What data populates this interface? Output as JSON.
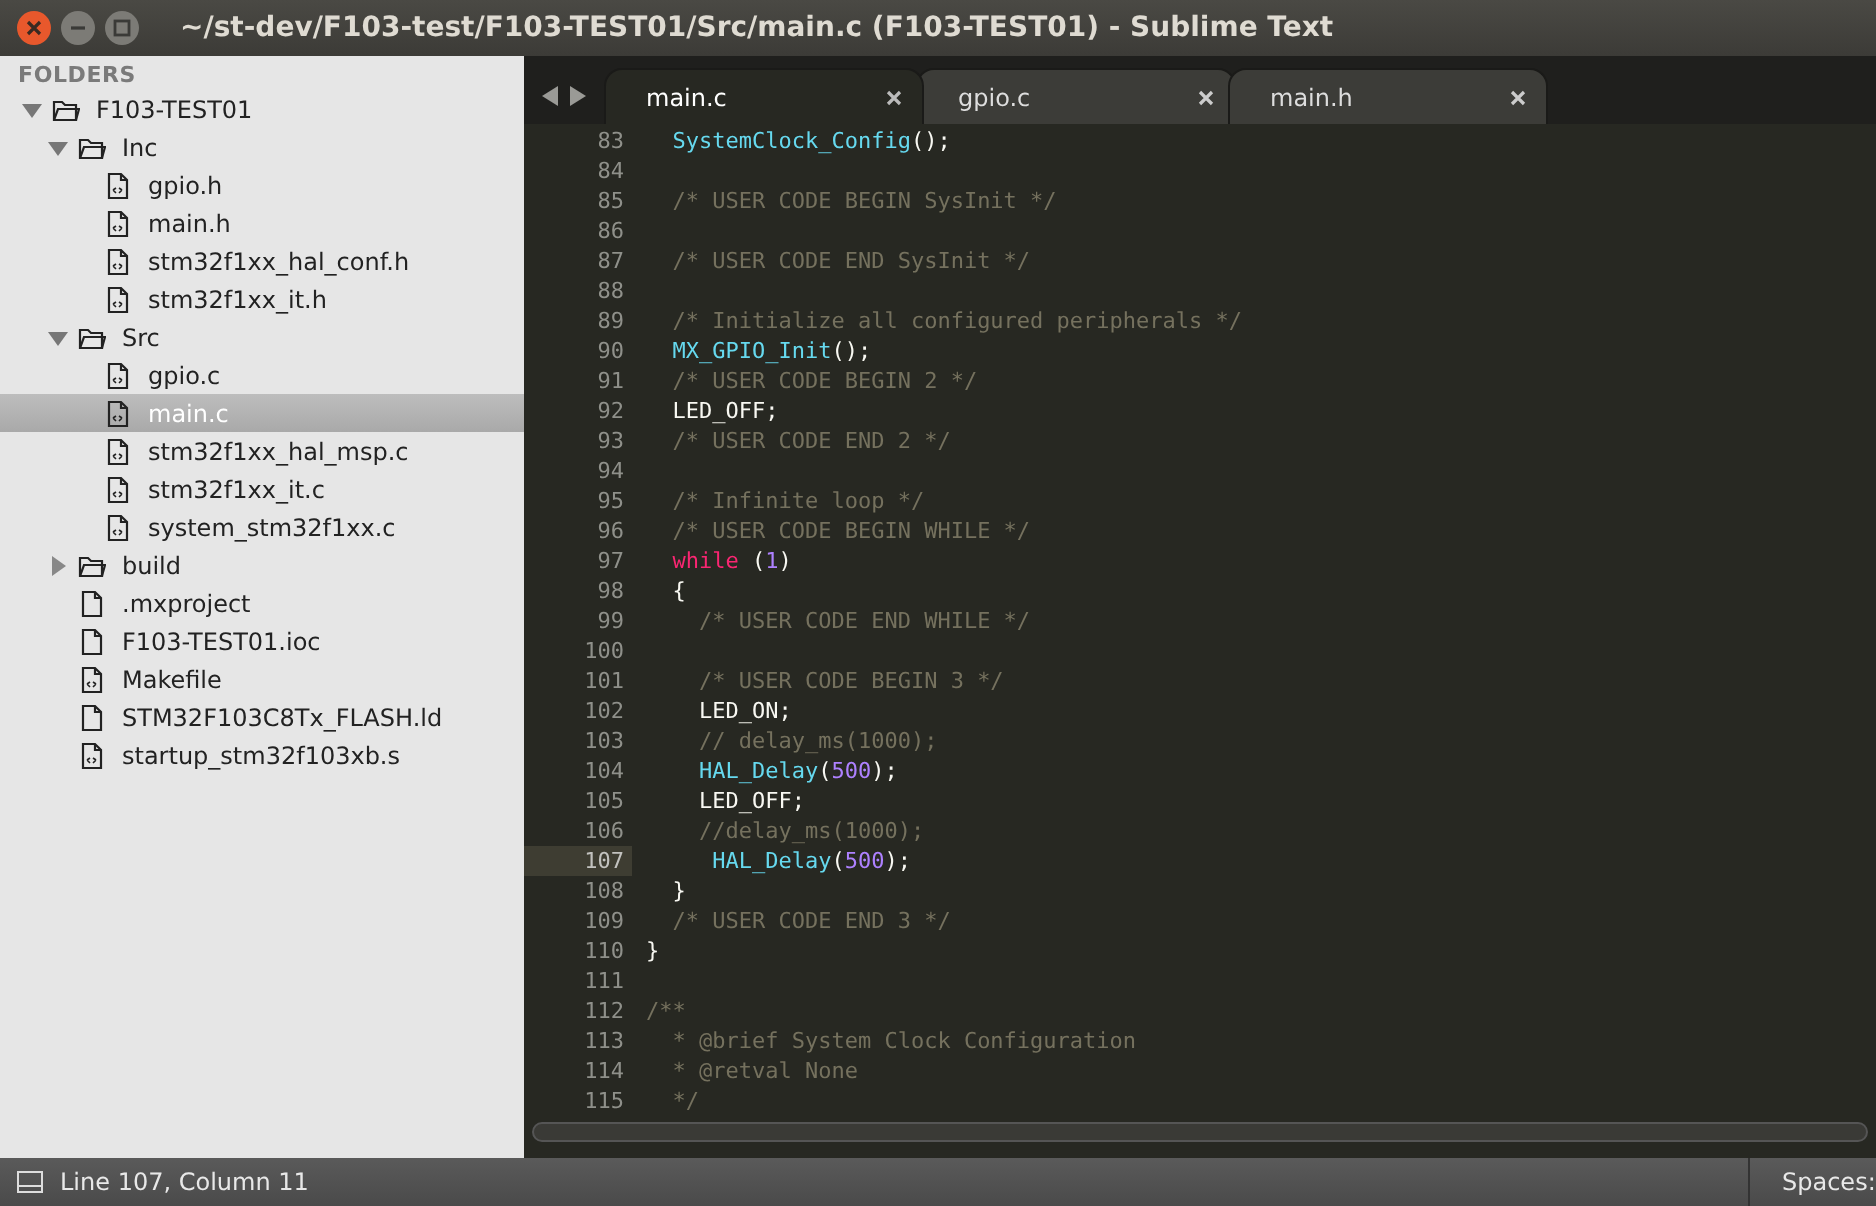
{
  "window": {
    "title": "~/st-dev/F103-test/F103-TEST01/Src/main.c (F103-TEST01) - Sublime Text"
  },
  "sidebar": {
    "heading": "FOLDERS",
    "tree": [
      {
        "label": "F103-TEST01",
        "kind": "folder",
        "expanded": true,
        "selected": false,
        "children": [
          {
            "label": "Inc",
            "kind": "folder",
            "expanded": true,
            "selected": false,
            "children": [
              {
                "label": "gpio.h",
                "kind": "code-file",
                "selected": false
              },
              {
                "label": "main.h",
                "kind": "code-file",
                "selected": false
              },
              {
                "label": "stm32f1xx_hal_conf.h",
                "kind": "code-file",
                "selected": false
              },
              {
                "label": "stm32f1xx_it.h",
                "kind": "code-file",
                "selected": false
              }
            ]
          },
          {
            "label": "Src",
            "kind": "folder",
            "expanded": true,
            "selected": false,
            "children": [
              {
                "label": "gpio.c",
                "kind": "code-file",
                "selected": false
              },
              {
                "label": "main.c",
                "kind": "code-file",
                "selected": true
              },
              {
                "label": "stm32f1xx_hal_msp.c",
                "kind": "code-file",
                "selected": false
              },
              {
                "label": "stm32f1xx_it.c",
                "kind": "code-file",
                "selected": false
              },
              {
                "label": "system_stm32f1xx.c",
                "kind": "code-file",
                "selected": false
              }
            ]
          },
          {
            "label": "build",
            "kind": "folder",
            "expanded": false,
            "selected": false
          },
          {
            "label": ".mxproject",
            "kind": "file",
            "selected": false
          },
          {
            "label": "F103-TEST01.ioc",
            "kind": "file",
            "selected": false
          },
          {
            "label": "Makefile",
            "kind": "code-file",
            "selected": false
          },
          {
            "label": "STM32F103C8Tx_FLASH.ld",
            "kind": "file",
            "selected": false
          },
          {
            "label": "startup_stm32f103xb.s",
            "kind": "code-file",
            "selected": false
          }
        ]
      }
    ]
  },
  "tabs": [
    {
      "label": "main.c",
      "selected": true
    },
    {
      "label": "gpio.c",
      "selected": false
    },
    {
      "label": "main.h",
      "selected": false
    }
  ],
  "code": [
    {
      "number": "83",
      "current": false,
      "tokens": [
        {
          "kind": "function",
          "text": "  SystemClock_Config"
        },
        {
          "kind": "plain",
          "text": "();"
        }
      ]
    },
    {
      "number": "84",
      "current": false
    },
    {
      "number": "85",
      "current": false,
      "tokens": [
        {
          "kind": "comment",
          "text": "  /* USER CODE BEGIN SysInit */"
        }
      ]
    },
    {
      "number": "86",
      "current": false
    },
    {
      "number": "87",
      "current": false,
      "tokens": [
        {
          "kind": "comment",
          "text": "  /* USER CODE END SysInit */"
        }
      ]
    },
    {
      "number": "88",
      "current": false
    },
    {
      "number": "89",
      "current": false,
      "tokens": [
        {
          "kind": "comment",
          "text": "  /* Initialize all configured peripherals */"
        }
      ]
    },
    {
      "number": "90",
      "current": false,
      "tokens": [
        {
          "kind": "function",
          "text": "  MX_GPIO_Init"
        },
        {
          "kind": "plain",
          "text": "();"
        }
      ]
    },
    {
      "number": "91",
      "current": false,
      "tokens": [
        {
          "kind": "comment",
          "text": "  /* USER CODE BEGIN 2 */"
        }
      ]
    },
    {
      "number": "92",
      "current": false,
      "tokens": [
        {
          "kind": "plain",
          "text": "  LED_OFF;"
        }
      ]
    },
    {
      "number": "93",
      "current": false,
      "tokens": [
        {
          "kind": "comment",
          "text": "  /* USER CODE END 2 */"
        }
      ]
    },
    {
      "number": "94",
      "current": false
    },
    {
      "number": "95",
      "current": false,
      "tokens": [
        {
          "kind": "comment",
          "text": "  /* Infinite loop */"
        }
      ]
    },
    {
      "number": "96",
      "current": false,
      "tokens": [
        {
          "kind": "comment",
          "text": "  /* USER CODE BEGIN WHILE */"
        }
      ]
    },
    {
      "number": "97",
      "current": false,
      "tokens": [
        {
          "kind": "keyword",
          "text": "  while"
        },
        {
          "kind": "plain",
          "text": " ("
        },
        {
          "kind": "number",
          "text": "1"
        },
        {
          "kind": "plain",
          "text": ")"
        }
      ]
    },
    {
      "number": "98",
      "current": false,
      "tokens": [
        {
          "kind": "plain",
          "text": "  {"
        }
      ]
    },
    {
      "number": "99",
      "current": false,
      "tokens": [
        {
          "kind": "comment",
          "text": "    /* USER CODE END WHILE */"
        }
      ]
    },
    {
      "number": "100",
      "current": false
    },
    {
      "number": "101",
      "current": false,
      "tokens": [
        {
          "kind": "comment",
          "text": "    /* USER CODE BEGIN 3 */"
        }
      ]
    },
    {
      "number": "102",
      "current": false,
      "tokens": [
        {
          "kind": "plain",
          "text": "    LED_ON;"
        }
      ]
    },
    {
      "number": "103",
      "current": false,
      "tokens": [
        {
          "kind": "comment",
          "text": "    // delay_ms(1000);"
        }
      ]
    },
    {
      "number": "104",
      "current": false,
      "tokens": [
        {
          "kind": "function",
          "text": "    HAL_Delay"
        },
        {
          "kind": "plain",
          "text": "("
        },
        {
          "kind": "number",
          "text": "500"
        },
        {
          "kind": "plain",
          "text": ");"
        }
      ]
    },
    {
      "number": "105",
      "current": false,
      "tokens": [
        {
          "kind": "plain",
          "text": "    LED_OFF;"
        }
      ]
    },
    {
      "number": "106",
      "current": false,
      "tokens": [
        {
          "kind": "comment",
          "text": "    //delay_ms(1000);"
        }
      ]
    },
    {
      "number": "107",
      "current": true,
      "tokens": [
        {
          "kind": "function",
          "text": "     HAL_Delay"
        },
        {
          "kind": "plain",
          "text": "("
        },
        {
          "kind": "number",
          "text": "500"
        },
        {
          "kind": "plain",
          "text": ");"
        }
      ]
    },
    {
      "number": "108",
      "current": false,
      "tokens": [
        {
          "kind": "plain",
          "text": "  }"
        }
      ]
    },
    {
      "number": "109",
      "current": false,
      "tokens": [
        {
          "kind": "comment",
          "text": "  /* USER CODE END 3 */"
        }
      ]
    },
    {
      "number": "110",
      "current": false,
      "tokens": [
        {
          "kind": "plain",
          "text": "}"
        }
      ]
    },
    {
      "number": "111",
      "current": false
    },
    {
      "number": "112",
      "current": false,
      "tokens": [
        {
          "kind": "comment",
          "text": "/**"
        }
      ]
    },
    {
      "number": "113",
      "current": false,
      "tokens": [
        {
          "kind": "comment",
          "text": "  * @brief System Clock Configuration"
        }
      ]
    },
    {
      "number": "114",
      "current": false,
      "tokens": [
        {
          "kind": "comment",
          "text": "  * @retval None"
        }
      ]
    },
    {
      "number": "115",
      "current": false,
      "tokens": [
        {
          "kind": "comment",
          "text": "  */"
        }
      ]
    }
  ],
  "status_bar": {
    "position": "Line 107, Column 11",
    "indentation": "Spaces:"
  }
}
